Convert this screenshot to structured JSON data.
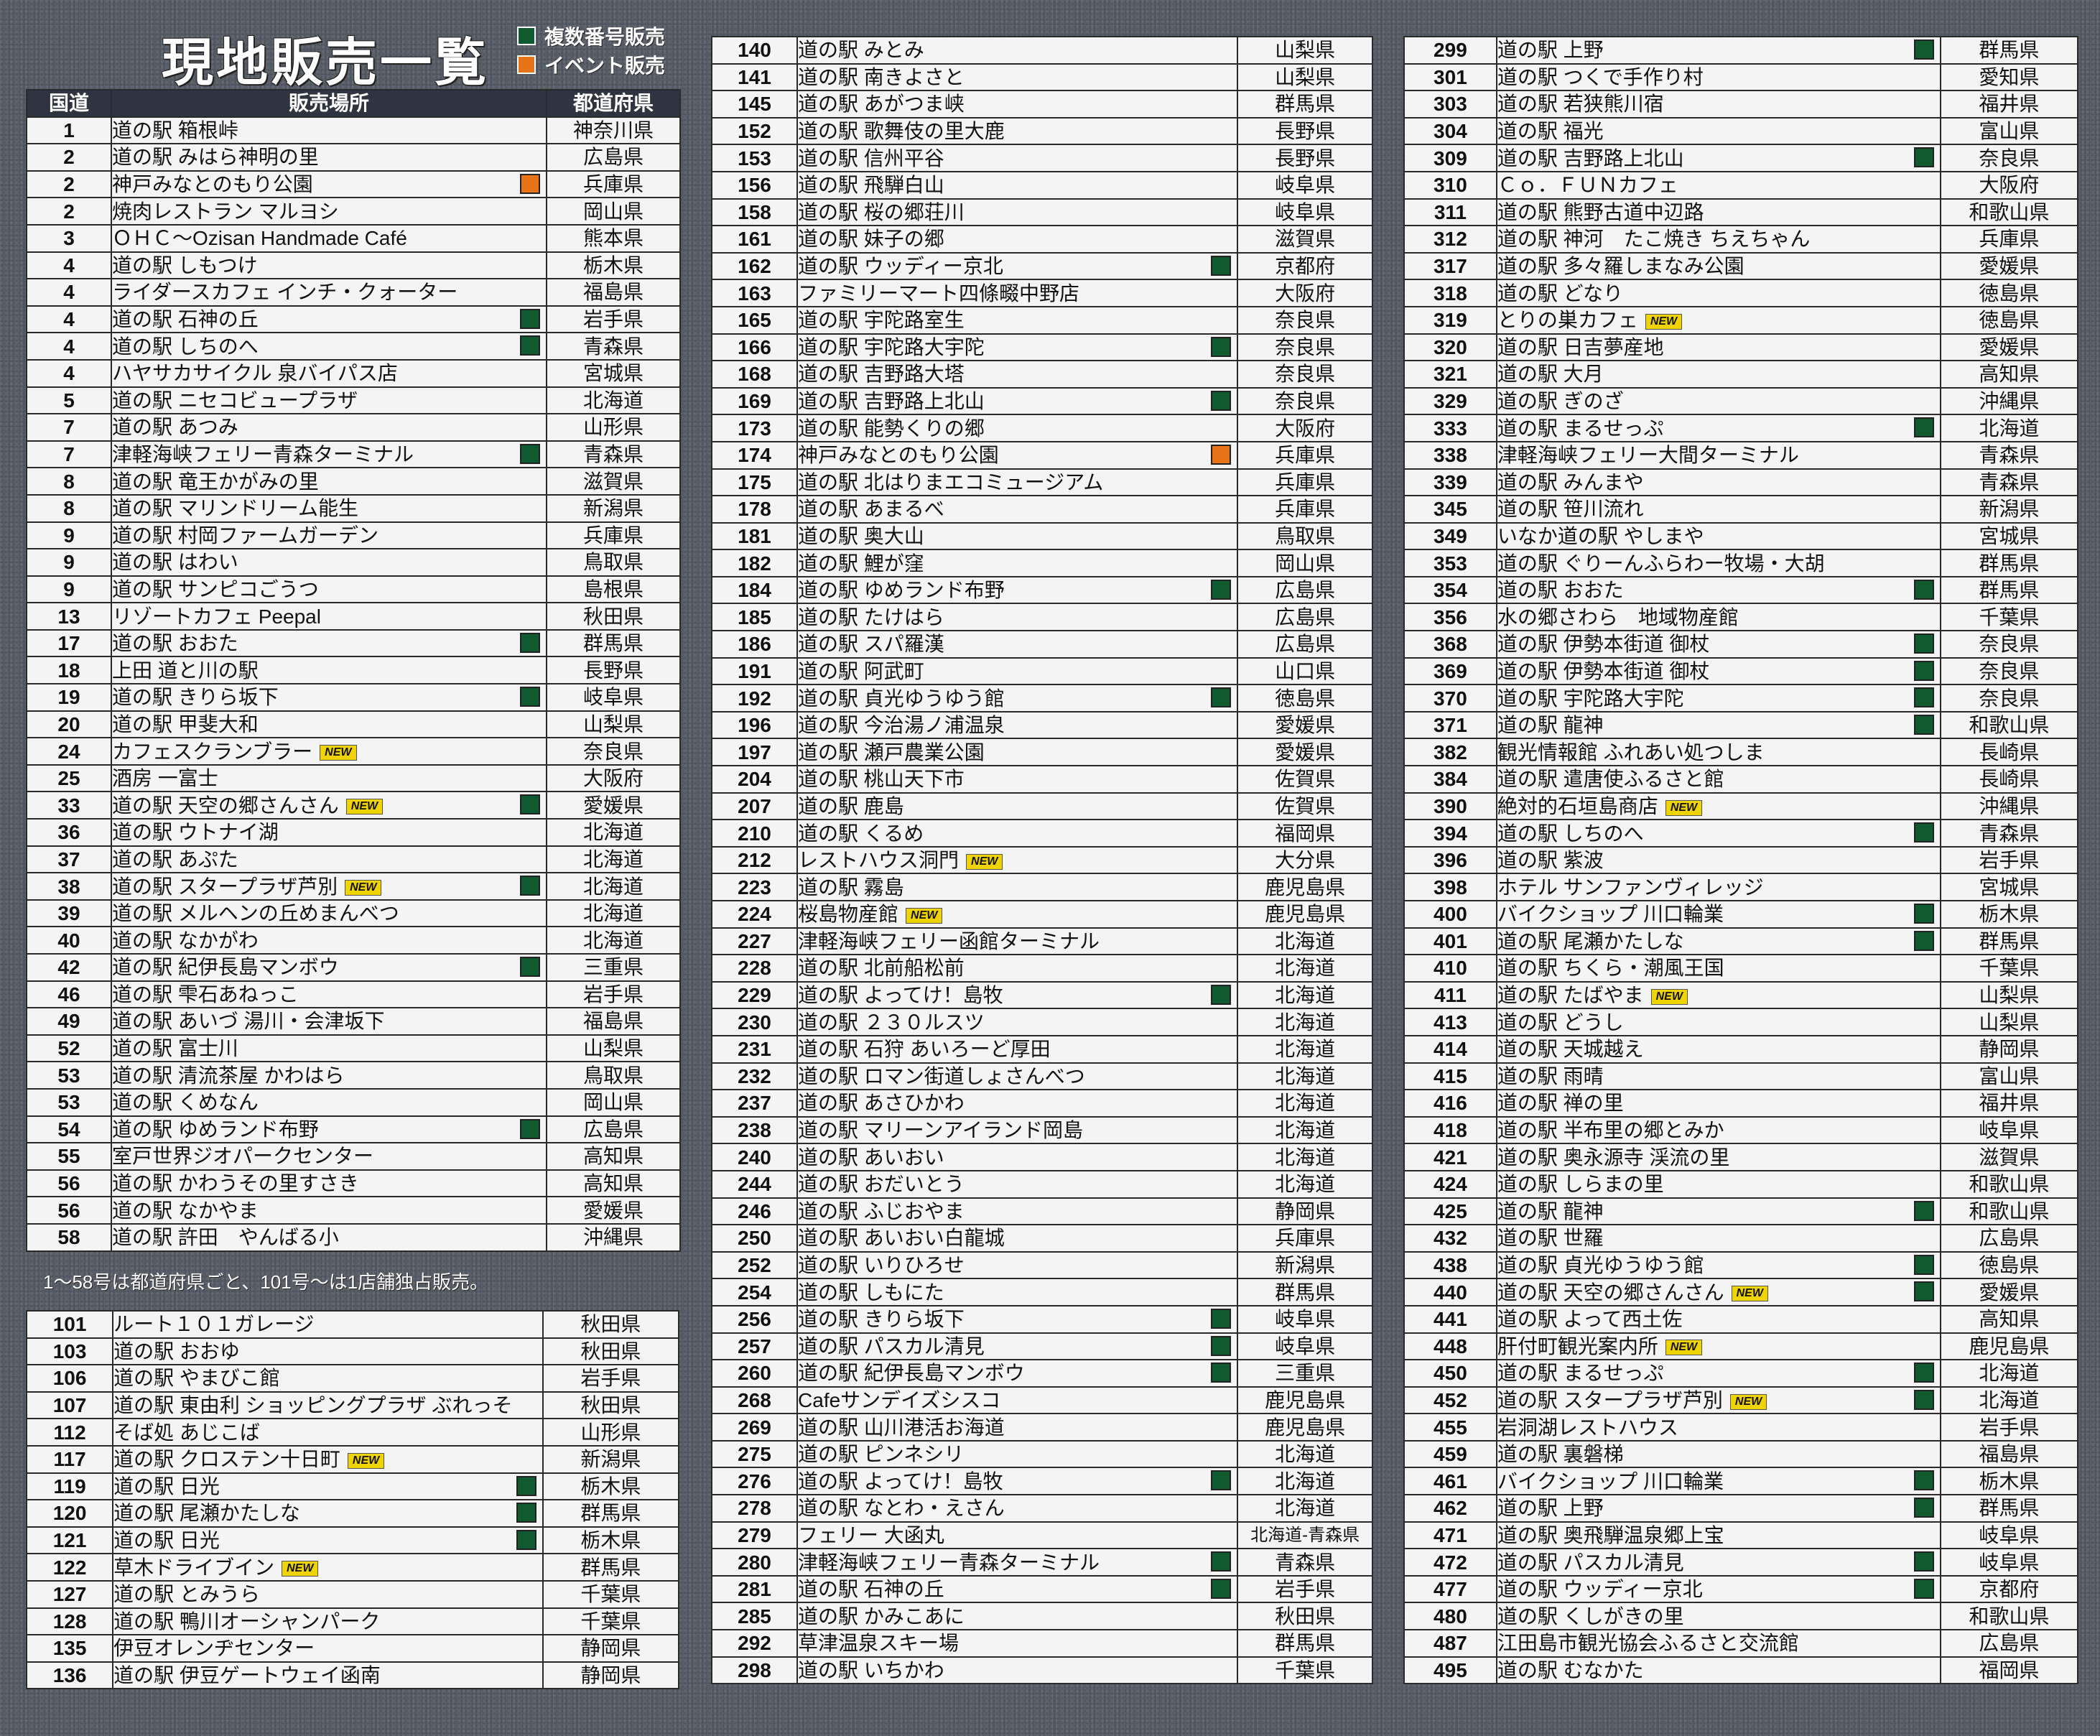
{
  "header": {
    "title": "現地販売一覧",
    "legend": [
      {
        "label": "複数番号販売",
        "color": "#0f5a2e"
      },
      {
        "label": "イベント販売",
        "color": "#e8741a"
      }
    ]
  },
  "columns": {
    "route": "国道",
    "place": "販売場所",
    "pref": "都道府県"
  },
  "colors": {
    "green": "#0f5a2e",
    "orange": "#e8741a"
  },
  "note": "1～58号は都道府県ごと、101号～は1店舗独占販売。",
  "col1a": [
    [
      "1",
      "道の駅 箱根峠",
      "",
      "",
      "神奈川県"
    ],
    [
      "2",
      "道の駅 みはら神明の里",
      "",
      "",
      "広島県"
    ],
    [
      "2",
      "神戸みなとのもり公園",
      "",
      "o",
      "兵庫県"
    ],
    [
      "2",
      "焼肉レストラン マルヨシ",
      "",
      "",
      "岡山県"
    ],
    [
      "3",
      "ＯＨＣ～Ozisan Handmade Café",
      "",
      "",
      "熊本県"
    ],
    [
      "4",
      "道の駅 しもつけ",
      "",
      "",
      "栃木県"
    ],
    [
      "4",
      "ライダースカフェ インチ・クォーター",
      "",
      "",
      "福島県"
    ],
    [
      "4",
      "道の駅 石神の丘",
      "",
      "g",
      "岩手県"
    ],
    [
      "4",
      "道の駅 しちのへ",
      "",
      "g",
      "青森県"
    ],
    [
      "4",
      "ハヤサカサイクル 泉バイパス店",
      "",
      "",
      "宮城県"
    ],
    [
      "5",
      "道の駅 ニセコビュープラザ",
      "",
      "",
      "北海道"
    ],
    [
      "7",
      "道の駅 あつみ",
      "",
      "",
      "山形県"
    ],
    [
      "7",
      "津軽海峡フェリー青森ターミナル",
      "",
      "g",
      "青森県"
    ],
    [
      "8",
      "道の駅 竜王かがみの里",
      "",
      "",
      "滋賀県"
    ],
    [
      "8",
      "道の駅 マリンドリーム能生",
      "",
      "",
      "新潟県"
    ],
    [
      "9",
      "道の駅 村岡ファームガーデン",
      "",
      "",
      "兵庫県"
    ],
    [
      "9",
      "道の駅 はわい",
      "",
      "",
      "鳥取県"
    ],
    [
      "9",
      "道の駅 サンピコごうつ",
      "",
      "",
      "島根県"
    ],
    [
      "13",
      "リゾートカフェ Peepal",
      "",
      "",
      "秋田県"
    ],
    [
      "17",
      "道の駅 おおた",
      "",
      "g",
      "群馬県"
    ],
    [
      "18",
      "上田 道と川の駅",
      "",
      "",
      "長野県"
    ],
    [
      "19",
      "道の駅 きりら坂下",
      "",
      "g",
      "岐阜県"
    ],
    [
      "20",
      "道の駅 甲斐大和",
      "",
      "",
      "山梨県"
    ],
    [
      "24",
      "カフェスクランブラー",
      "NEW",
      "",
      "奈良県"
    ],
    [
      "25",
      "酒房 一富士",
      "",
      "",
      "大阪府"
    ],
    [
      "33",
      "道の駅 天空の郷さんさん",
      "NEW",
      "g",
      "愛媛県"
    ],
    [
      "36",
      "道の駅 ウトナイ湖",
      "",
      "",
      "北海道"
    ],
    [
      "37",
      "道の駅 あぷた",
      "",
      "",
      "北海道"
    ],
    [
      "38",
      "道の駅 スタープラザ芦別",
      "NEW",
      "g",
      "北海道"
    ],
    [
      "39",
      "道の駅 メルヘンの丘めまんべつ",
      "",
      "",
      "北海道"
    ],
    [
      "40",
      "道の駅 なかがわ",
      "",
      "",
      "北海道"
    ],
    [
      "42",
      "道の駅 紀伊長島マンボウ",
      "",
      "g",
      "三重県"
    ],
    [
      "46",
      "道の駅 雫石あねっこ",
      "",
      "",
      "岩手県"
    ],
    [
      "49",
      "道の駅 あいづ 湯川・会津坂下",
      "",
      "",
      "福島県"
    ],
    [
      "52",
      "道の駅 富士川",
      "",
      "",
      "山梨県"
    ],
    [
      "53",
      "道の駅 清流茶屋 かわはら",
      "",
      "",
      "鳥取県"
    ],
    [
      "53",
      "道の駅 くめなん",
      "",
      "",
      "岡山県"
    ],
    [
      "54",
      "道の駅 ゆめランド布野",
      "",
      "g",
      "広島県"
    ],
    [
      "55",
      "室戸世界ジオパークセンター",
      "",
      "",
      "高知県"
    ],
    [
      "56",
      "道の駅 かわうその里すさき",
      "",
      "",
      "高知県"
    ],
    [
      "56",
      "道の駅 なかやま",
      "",
      "",
      "愛媛県"
    ],
    [
      "58",
      "道の駅 許田　やんばる小",
      "",
      "",
      "沖縄県"
    ]
  ],
  "col1b": [
    [
      "101",
      "ルート１０１ガレージ",
      "",
      "",
      "秋田県"
    ],
    [
      "103",
      "道の駅 おおゆ",
      "",
      "",
      "秋田県"
    ],
    [
      "106",
      "道の駅 やまびこ館",
      "",
      "",
      "岩手県"
    ],
    [
      "107",
      "道の駅 東由利 ショッピングプラザ ぶれっそ",
      "",
      "",
      "秋田県"
    ],
    [
      "112",
      "そば処 あじこば",
      "",
      "",
      "山形県"
    ],
    [
      "117",
      "道の駅 クロステン十日町",
      "NEW",
      "",
      "新潟県"
    ],
    [
      "119",
      "道の駅 日光",
      "",
      "g",
      "栃木県"
    ],
    [
      "120",
      "道の駅 尾瀬かたしな",
      "",
      "g",
      "群馬県"
    ],
    [
      "121",
      "道の駅 日光",
      "",
      "g",
      "栃木県"
    ],
    [
      "122",
      "草木ドライブイン",
      "NEW",
      "",
      "群馬県"
    ],
    [
      "127",
      "道の駅 とみうら",
      "",
      "",
      "千葉県"
    ],
    [
      "128",
      "道の駅 鴨川オーシャンパーク",
      "",
      "",
      "千葉県"
    ],
    [
      "135",
      "伊豆オレンヂセンター",
      "",
      "",
      "静岡県"
    ],
    [
      "136",
      "道の駅 伊豆ゲートウェイ函南",
      "",
      "",
      "静岡県"
    ]
  ],
  "col2": [
    [
      "140",
      "道の駅 みとみ",
      "",
      "",
      "山梨県"
    ],
    [
      "141",
      "道の駅 南きよさと",
      "",
      "",
      "山梨県"
    ],
    [
      "145",
      "道の駅 あがつま峡",
      "",
      "",
      "群馬県"
    ],
    [
      "152",
      "道の駅 歌舞伎の里大鹿",
      "",
      "",
      "長野県"
    ],
    [
      "153",
      "道の駅 信州平谷",
      "",
      "",
      "長野県"
    ],
    [
      "156",
      "道の駅 飛騨白山",
      "",
      "",
      "岐阜県"
    ],
    [
      "158",
      "道の駅 桜の郷荘川",
      "",
      "",
      "岐阜県"
    ],
    [
      "161",
      "道の駅 妹子の郷",
      "",
      "",
      "滋賀県"
    ],
    [
      "162",
      "道の駅 ウッディー京北",
      "",
      "g",
      "京都府"
    ],
    [
      "163",
      "ファミリーマート四條畷中野店",
      "",
      "",
      "大阪府"
    ],
    [
      "165",
      "道の駅 宇陀路室生",
      "",
      "",
      "奈良県"
    ],
    [
      "166",
      "道の駅 宇陀路大宇陀",
      "",
      "g",
      "奈良県"
    ],
    [
      "168",
      "道の駅 吉野路大塔",
      "",
      "",
      "奈良県"
    ],
    [
      "169",
      "道の駅 吉野路上北山",
      "",
      "g",
      "奈良県"
    ],
    [
      "173",
      "道の駅 能勢くりの郷",
      "",
      "",
      "大阪府"
    ],
    [
      "174",
      "神戸みなとのもり公園",
      "",
      "o",
      "兵庫県"
    ],
    [
      "175",
      "道の駅 北はりまエコミュージアム",
      "",
      "",
      "兵庫県"
    ],
    [
      "178",
      "道の駅 あまるべ",
      "",
      "",
      "兵庫県"
    ],
    [
      "181",
      "道の駅 奥大山",
      "",
      "",
      "鳥取県"
    ],
    [
      "182",
      "道の駅 鯉が窪",
      "",
      "",
      "岡山県"
    ],
    [
      "184",
      "道の駅 ゆめランド布野",
      "",
      "g",
      "広島県"
    ],
    [
      "185",
      "道の駅 たけはら",
      "",
      "",
      "広島県"
    ],
    [
      "186",
      "道の駅 スパ羅漢",
      "",
      "",
      "広島県"
    ],
    [
      "191",
      "道の駅 阿武町",
      "",
      "",
      "山口県"
    ],
    [
      "192",
      "道の駅 貞光ゆうゆう館",
      "",
      "g",
      "徳島県"
    ],
    [
      "196",
      "道の駅 今治湯ノ浦温泉",
      "",
      "",
      "愛媛県"
    ],
    [
      "197",
      "道の駅 瀬戸農業公園",
      "",
      "",
      "愛媛県"
    ],
    [
      "204",
      "道の駅 桃山天下市",
      "",
      "",
      "佐賀県"
    ],
    [
      "207",
      "道の駅 鹿島",
      "",
      "",
      "佐賀県"
    ],
    [
      "210",
      "道の駅 くるめ",
      "",
      "",
      "福岡県"
    ],
    [
      "212",
      "レストハウス洞門",
      "NEW",
      "",
      "大分県"
    ],
    [
      "223",
      "道の駅 霧島",
      "",
      "",
      "鹿児島県"
    ],
    [
      "224",
      "桜島物産館",
      "NEW",
      "",
      "鹿児島県"
    ],
    [
      "227",
      "津軽海峡フェリー函館ターミナル",
      "",
      "",
      "北海道"
    ],
    [
      "228",
      "道の駅 北前船松前",
      "",
      "",
      "北海道"
    ],
    [
      "229",
      "道の駅 よってけ！島牧",
      "",
      "g",
      "北海道"
    ],
    [
      "230",
      "道の駅 ２３０ルスツ",
      "",
      "",
      "北海道"
    ],
    [
      "231",
      "道の駅 石狩 あいろーど厚田",
      "",
      "",
      "北海道"
    ],
    [
      "232",
      "道の駅 ロマン街道しょさんべつ",
      "",
      "",
      "北海道"
    ],
    [
      "237",
      "道の駅 あさひかわ",
      "",
      "",
      "北海道"
    ],
    [
      "238",
      "道の駅 マリーンアイランド岡島",
      "",
      "",
      "北海道"
    ],
    [
      "240",
      "道の駅 あいおい",
      "",
      "",
      "北海道"
    ],
    [
      "244",
      "道の駅 おだいとう",
      "",
      "",
      "北海道"
    ],
    [
      "246",
      "道の駅 ふじおやま",
      "",
      "",
      "静岡県"
    ],
    [
      "250",
      "道の駅 あいおい白龍城",
      "",
      "",
      "兵庫県"
    ],
    [
      "252",
      "道の駅 いりひろせ",
      "",
      "",
      "新潟県"
    ],
    [
      "254",
      "道の駅 しもにた",
      "",
      "",
      "群馬県"
    ],
    [
      "256",
      "道の駅 きりら坂下",
      "",
      "g",
      "岐阜県"
    ],
    [
      "257",
      "道の駅 パスカル清見",
      "",
      "g",
      "岐阜県"
    ],
    [
      "260",
      "道の駅 紀伊長島マンボウ",
      "",
      "g",
      "三重県"
    ],
    [
      "268",
      "Cafeサンデイズシスコ",
      "",
      "",
      "鹿児島県"
    ],
    [
      "269",
      "道の駅 山川港活お海道",
      "",
      "",
      "鹿児島県"
    ],
    [
      "275",
      "道の駅 ピンネシリ",
      "",
      "",
      "北海道"
    ],
    [
      "276",
      "道の駅 よってけ！島牧",
      "",
      "g",
      "北海道"
    ],
    [
      "278",
      "道の駅 なとわ・えさん",
      "",
      "",
      "北海道"
    ],
    [
      "279",
      "フェリー 大函丸",
      "",
      "",
      "北海道-青森県"
    ],
    [
      "280",
      "津軽海峡フェリー青森ターミナル",
      "",
      "g",
      "青森県"
    ],
    [
      "281",
      "道の駅 石神の丘",
      "",
      "g",
      "岩手県"
    ],
    [
      "285",
      "道の駅 かみこあに",
      "",
      "",
      "秋田県"
    ],
    [
      "292",
      "草津温泉スキー場",
      "",
      "",
      "群馬県"
    ],
    [
      "298",
      "道の駅 いちかわ",
      "",
      "",
      "千葉県"
    ]
  ],
  "col3": [
    [
      "299",
      "道の駅 上野",
      "",
      "g",
      "群馬県"
    ],
    [
      "301",
      "道の駅 つくで手作り村",
      "",
      "",
      "愛知県"
    ],
    [
      "303",
      "道の駅 若狭熊川宿",
      "",
      "",
      "福井県"
    ],
    [
      "304",
      "道の駅 福光",
      "",
      "",
      "富山県"
    ],
    [
      "309",
      "道の駅 吉野路上北山",
      "",
      "g",
      "奈良県"
    ],
    [
      "310",
      "Ｃｏ．ＦＵＮカフェ",
      "",
      "",
      "大阪府"
    ],
    [
      "311",
      "道の駅 熊野古道中辺路",
      "",
      "",
      "和歌山県"
    ],
    [
      "312",
      "道の駅 神河　たこ焼き ちえちゃん",
      "",
      "",
      "兵庫県"
    ],
    [
      "317",
      "道の駅 多々羅しまなみ公園",
      "",
      "",
      "愛媛県"
    ],
    [
      "318",
      "道の駅 どなり",
      "",
      "",
      "徳島県"
    ],
    [
      "319",
      "とりの巣カフェ",
      "NEW",
      "",
      "徳島県"
    ],
    [
      "320",
      "道の駅 日吉夢産地",
      "",
      "",
      "愛媛県"
    ],
    [
      "321",
      "道の駅 大月",
      "",
      "",
      "高知県"
    ],
    [
      "329",
      "道の駅 ぎのざ",
      "",
      "",
      "沖縄県"
    ],
    [
      "333",
      "道の駅 まるせっぷ",
      "",
      "g",
      "北海道"
    ],
    [
      "338",
      "津軽海峡フェリー大間ターミナル",
      "",
      "",
      "青森県"
    ],
    [
      "339",
      "道の駅 みんまや",
      "",
      "",
      "青森県"
    ],
    [
      "345",
      "道の駅 笹川流れ",
      "",
      "",
      "新潟県"
    ],
    [
      "349",
      "いなか道の駅 やしまや",
      "",
      "",
      "宮城県"
    ],
    [
      "353",
      "道の駅 ぐりーんふらわー牧場・大胡",
      "",
      "",
      "群馬県"
    ],
    [
      "354",
      "道の駅 おおた",
      "",
      "g",
      "群馬県"
    ],
    [
      "356",
      "水の郷さわら　地域物産館",
      "",
      "",
      "千葉県"
    ],
    [
      "368",
      "道の駅 伊勢本街道 御杖",
      "",
      "g",
      "奈良県"
    ],
    [
      "369",
      "道の駅 伊勢本街道 御杖",
      "",
      "g",
      "奈良県"
    ],
    [
      "370",
      "道の駅 宇陀路大宇陀",
      "",
      "g",
      "奈良県"
    ],
    [
      "371",
      "道の駅 龍神",
      "",
      "g",
      "和歌山県"
    ],
    [
      "382",
      "観光情報館 ふれあい処つしま",
      "",
      "",
      "長崎県"
    ],
    [
      "384",
      "道の駅 遣唐使ふるさと館",
      "",
      "",
      "長崎県"
    ],
    [
      "390",
      "絶対的石垣島商店",
      "NEW",
      "",
      "沖縄県"
    ],
    [
      "394",
      "道の駅 しちのへ",
      "",
      "g",
      "青森県"
    ],
    [
      "396",
      "道の駅 紫波",
      "",
      "",
      "岩手県"
    ],
    [
      "398",
      "ホテル サンファンヴィレッジ",
      "",
      "",
      "宮城県"
    ],
    [
      "400",
      "バイクショップ 川口輪業",
      "",
      "g",
      "栃木県"
    ],
    [
      "401",
      "道の駅 尾瀬かたしな",
      "",
      "g",
      "群馬県"
    ],
    [
      "410",
      "道の駅 ちくら・潮風王国",
      "",
      "",
      "千葉県"
    ],
    [
      "411",
      "道の駅 たばやま",
      "NEW",
      "",
      "山梨県"
    ],
    [
      "413",
      "道の駅 どうし",
      "",
      "",
      "山梨県"
    ],
    [
      "414",
      "道の駅 天城越え",
      "",
      "",
      "静岡県"
    ],
    [
      "415",
      "道の駅 雨晴",
      "",
      "",
      "富山県"
    ],
    [
      "416",
      "道の駅 禅の里",
      "",
      "",
      "福井県"
    ],
    [
      "418",
      "道の駅 半布里の郷とみか",
      "",
      "",
      "岐阜県"
    ],
    [
      "421",
      "道の駅 奥永源寺 渓流の里",
      "",
      "",
      "滋賀県"
    ],
    [
      "424",
      "道の駅 しらまの里",
      "",
      "",
      "和歌山県"
    ],
    [
      "425",
      "道の駅 龍神",
      "",
      "g",
      "和歌山県"
    ],
    [
      "432",
      "道の駅 世羅",
      "",
      "",
      "広島県"
    ],
    [
      "438",
      "道の駅 貞光ゆうゆう館",
      "",
      "g",
      "徳島県"
    ],
    [
      "440",
      "道の駅 天空の郷さんさん",
      "NEW",
      "g",
      "愛媛県"
    ],
    [
      "441",
      "道の駅 よって西土佐",
      "",
      "",
      "高知県"
    ],
    [
      "448",
      "肝付町観光案内所",
      "NEW",
      "",
      "鹿児島県"
    ],
    [
      "450",
      "道の駅 まるせっぷ",
      "",
      "g",
      "北海道"
    ],
    [
      "452",
      "道の駅 スタープラザ芦別",
      "NEW",
      "g",
      "北海道"
    ],
    [
      "455",
      "岩洞湖レストハウス",
      "",
      "",
      "岩手県"
    ],
    [
      "459",
      "道の駅 裏磐梯",
      "",
      "",
      "福島県"
    ],
    [
      "461",
      "バイクショップ 川口輪業",
      "",
      "g",
      "栃木県"
    ],
    [
      "462",
      "道の駅 上野",
      "",
      "g",
      "群馬県"
    ],
    [
      "471",
      "道の駅 奥飛騨温泉郷上宝",
      "",
      "",
      "岐阜県"
    ],
    [
      "472",
      "道の駅 パスカル清見",
      "",
      "g",
      "岐阜県"
    ],
    [
      "477",
      "道の駅 ウッディー京北",
      "",
      "g",
      "京都府"
    ],
    [
      "480",
      "道の駅 くしがきの里",
      "",
      "",
      "和歌山県"
    ],
    [
      "487",
      "江田島市観光協会ふるさと交流館",
      "",
      "",
      "広島県"
    ],
    [
      "495",
      "道の駅 むなかた",
      "",
      "",
      "福岡県"
    ]
  ]
}
